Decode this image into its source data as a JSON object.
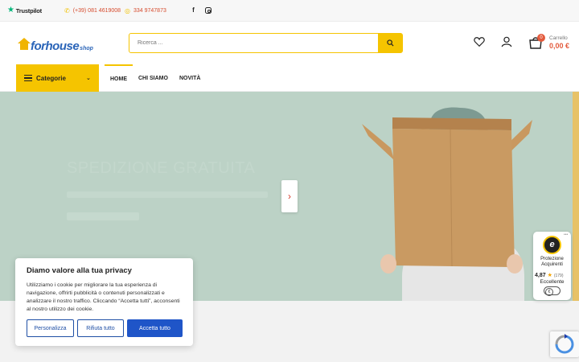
{
  "topbar": {
    "trustpilot": "Trustpilot",
    "phone_1": "(+39) 081 4619008",
    "phone_2": "334 9747873",
    "social_icons": [
      "facebook-icon",
      "instagram-icon"
    ]
  },
  "header": {
    "logo_main": "forhouse",
    "logo_sub": "shop",
    "search_placeholder": "Ricerca ...",
    "cart_count": "0",
    "cart_label": "Carrello",
    "cart_total": "0,00 €"
  },
  "nav": {
    "categories_label": "Categorie",
    "items": [
      {
        "label": "HOME",
        "active": true
      },
      {
        "label": "CHI SIAMO",
        "active": false
      },
      {
        "label": "NOVITÀ",
        "active": false
      }
    ]
  },
  "hero": {
    "title": "SPEDIZIONE GRATUITA"
  },
  "privacy": {
    "title": "Diamo valore alla tua privacy",
    "text": "Utilizziamo i cookie per migliorare la tua esperienza di navigazione, offrirti pubblicità o contenuti personalizzati e analizzare il nostro traffico. Cliccando “Accetta tutti”, acconsenti al nostro utilizzo dei cookie.",
    "customize": "Personalizza",
    "reject": "Rifiuta tutto",
    "accept": "Accetta tutto"
  },
  "trusted_shops": {
    "label": "Protezione Acquirenti",
    "rating": "4,87",
    "count": "(179)",
    "grade": "Eccellente"
  },
  "colors": {
    "accent": "#f5c400",
    "brand_blue": "#2a64b8",
    "price_red": "#e35a3c",
    "hero_bg": "#bcd2c6"
  }
}
